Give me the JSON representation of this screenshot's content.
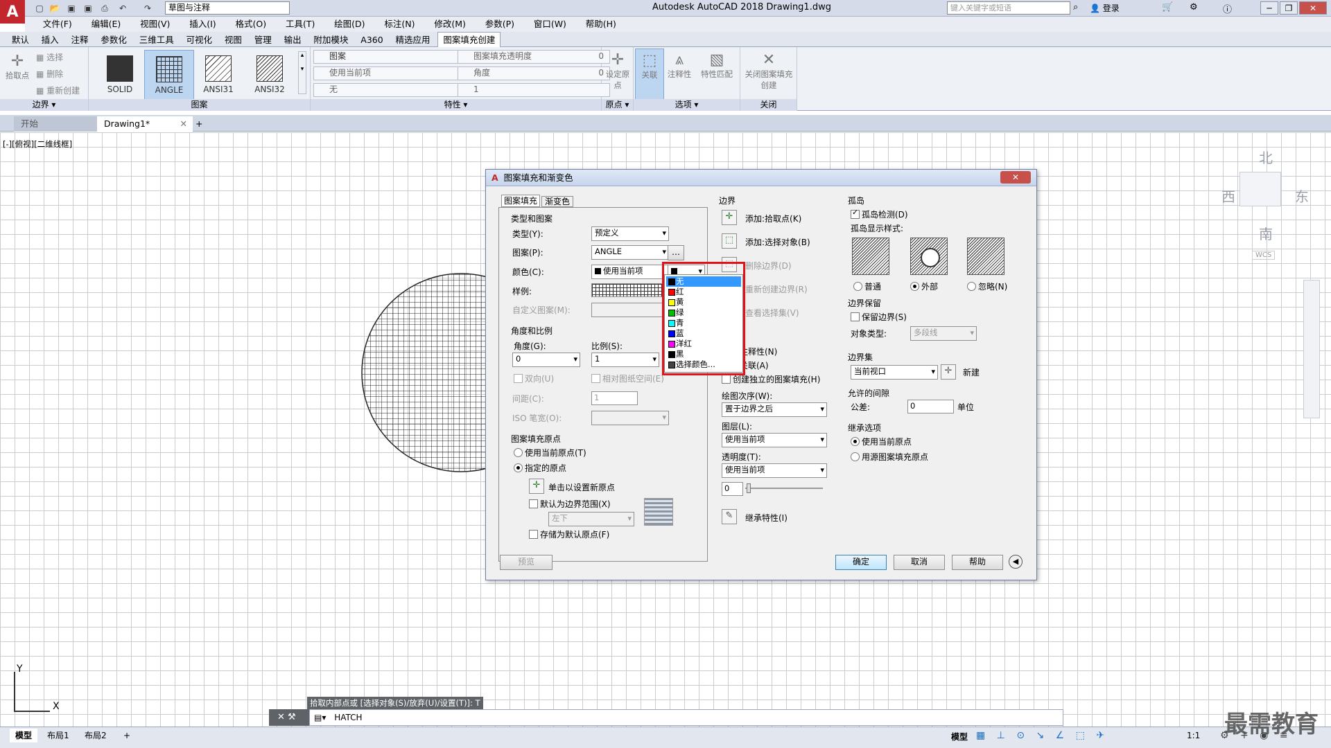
{
  "app": {
    "logo": "A",
    "workspace": "草图与注释",
    "title": "Autodesk AutoCAD 2018    Drawing1.dwg",
    "search_placeholder": "键入关键字或短语",
    "login": "登录"
  },
  "menu": [
    "文件(F)",
    "编辑(E)",
    "视图(V)",
    "插入(I)",
    "格式(O)",
    "工具(T)",
    "绘图(D)",
    "标注(N)",
    "修改(M)",
    "参数(P)",
    "窗口(W)",
    "帮助(H)"
  ],
  "ribbon_tabs": [
    "默认",
    "插入",
    "注释",
    "参数化",
    "三维工具",
    "可视化",
    "视图",
    "管理",
    "输出",
    "附加模块",
    "A360",
    "精选应用",
    "图案填充创建"
  ],
  "ribbon": {
    "boundary": {
      "pick": "拾取点",
      "select": "选择",
      "remove": "删除",
      "recreate": "重新创建",
      "title": "边界"
    },
    "pattern": {
      "items": [
        "SOLID",
        "ANGLE",
        "ANSI31",
        "ANSI32"
      ],
      "title": "图案"
    },
    "properties": {
      "type": "图案",
      "transparency": "图案填充透明度",
      "transparency_val": "0",
      "use_current": "使用当前项",
      "angle": "角度",
      "angle_val": "0",
      "none": "无",
      "scale_val": "1",
      "title": "特性"
    },
    "origin": {
      "set": "设定原点",
      "title": "原点"
    },
    "options": {
      "assoc": "关联",
      "annot": "注释性",
      "match": "特性匹配",
      "title": "选项"
    },
    "close": {
      "label": "关闭图案填充创建",
      "title": "关闭"
    }
  },
  "doc_tabs": {
    "start": "开始",
    "drawing": "Drawing1*"
  },
  "viewport_label": "[-][俯视][二维线框]",
  "compass": {
    "n": "北",
    "s": "南",
    "e": "东",
    "w": "西",
    "wcs": "WCS"
  },
  "dialog": {
    "title": "图案填充和渐变色",
    "tab_hatch": "图案填充",
    "tab_gradient": "渐变色",
    "type_pattern": "类型和图案",
    "type_label": "类型(Y):",
    "type_value": "预定义",
    "pattern_label": "图案(P):",
    "pattern_value": "ANGLE",
    "color_label": "颜色(C):",
    "color_value": "使用当前项",
    "sample_label": "样例:",
    "custom_label": "自定义图案(M):",
    "angle_scale": "角度和比例",
    "angle_label": "角度(G):",
    "angle_value": "0",
    "scale_label": "比例(S):",
    "scale_value": "1",
    "double": "双向(U)",
    "relative": "相对图纸空间(E)",
    "spacing_label": "间距(C):",
    "spacing_value": "1",
    "iso_label": "ISO 笔宽(O):",
    "origin_group": "图案填充原点",
    "use_current_origin": "使用当前原点(T)",
    "specified_origin": "指定的原点",
    "click_set": "单击以设置新原点",
    "default_extents": "默认为边界范围(X)",
    "extents_value": "左下",
    "store_default": "存储为默认原点(F)",
    "boundary": "边界",
    "add_pick": "添加:拾取点(K)",
    "add_select": "添加:选择对象(B)",
    "remove_boundary": "删除边界(D)",
    "recreate_boundary": "重新创建边界(R)",
    "view_selection": "查看选择集(V)",
    "options_annot": "注释性(N)",
    "options_assoc": "关联(A)",
    "create_separate": "创建独立的图案填充(H)",
    "draw_order_label": "绘图次序(W):",
    "draw_order_value": "置于边界之后",
    "layer_label": "图层(L):",
    "layer_value": "使用当前项",
    "transp_label": "透明度(T):",
    "transp_value": "使用当前项",
    "transp_num": "0",
    "inherit": "继承特性(I)",
    "islands": "孤岛",
    "island_detect": "孤岛检测(D)",
    "island_style": "孤岛显示样式:",
    "style_normal": "普通",
    "style_outer": "外部",
    "style_ignore": "忽略(N)",
    "retain": "边界保留",
    "retain_boundary": "保留边界(S)",
    "object_type_label": "对象类型:",
    "object_type_value": "多段线",
    "boundary_set": "边界集",
    "boundary_set_value": "当前视口",
    "new": "新建",
    "gap": "允许的间隙",
    "tolerance_label": "公差:",
    "tolerance_value": "0",
    "unit": "单位",
    "inherit_opts": "继承选项",
    "inherit_current": "使用当前原点",
    "inherit_source": "用源图案填充原点",
    "preview": "预览",
    "ok": "确定",
    "cancel": "取消",
    "help": "帮助"
  },
  "color_dropdown": [
    {
      "label": "无",
      "color": "#000000"
    },
    {
      "label": "红",
      "color": "#ff0000"
    },
    {
      "label": "黄",
      "color": "#ffff00"
    },
    {
      "label": "绿",
      "color": "#00c000"
    },
    {
      "label": "青",
      "color": "#00ffff"
    },
    {
      "label": "蓝",
      "color": "#0000ff"
    },
    {
      "label": "洋红",
      "color": "#ff00ff"
    },
    {
      "label": "黑",
      "color": "#000000"
    },
    {
      "label": "选择颜色...",
      "color": "#444444"
    }
  ],
  "command": {
    "hint": "拾取内部点或 [选择对象(S)/放弃(U)/设置(T)]: T",
    "current": "HATCH"
  },
  "status": {
    "model": "模型",
    "layout1": "布局1",
    "layout2": "布局2",
    "model_right": "模型",
    "scale": "1:1"
  },
  "watermark": "最需教育",
  "accent_color": "#1e6fc8"
}
